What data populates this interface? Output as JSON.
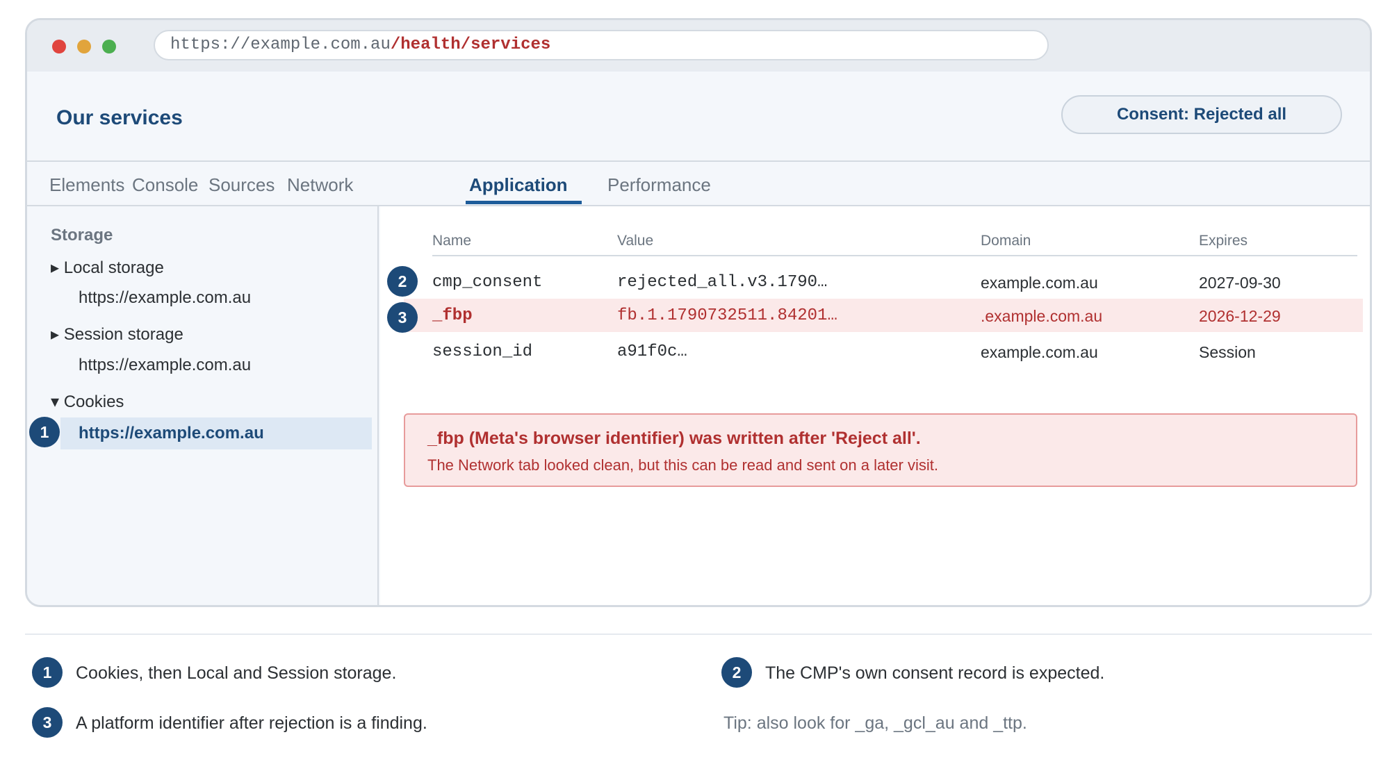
{
  "browser": {
    "url_base": "https://example.com.au",
    "url_path": "/health/services"
  },
  "page": {
    "title": "Our services",
    "consent_status": "Consent: Rejected all"
  },
  "devtools": {
    "tabs": [
      "Elements",
      "Console",
      "Sources",
      "Network",
      "Application",
      "Performance"
    ],
    "active_tab": "Application"
  },
  "sidebar": {
    "heading": "Storage",
    "local_storage": {
      "label": "▸ Local storage",
      "origin": "https://example.com.au"
    },
    "session_storage": {
      "label": "▸ Session storage",
      "origin": "https://example.com.au"
    },
    "cookies": {
      "label": "▾ Cookies",
      "origin": "https://example.com.au"
    }
  },
  "cookie_table": {
    "columns": [
      "Name",
      "Value",
      "Domain",
      "Expires"
    ],
    "rows": [
      {
        "badge": "2",
        "name": "cmp_consent",
        "value": "rejected_all.v3.1790…",
        "domain": "example.com.au",
        "expires": "2027-09-30",
        "highlight": false
      },
      {
        "badge": "3",
        "name": "_fbp",
        "value": "fb.1.1790732511.84201…",
        "domain": ".example.com.au",
        "expires": "2026-12-29",
        "highlight": true
      },
      {
        "badge": "",
        "name": "session_id",
        "value": "a91f0c…",
        "domain": "example.com.au",
        "expires": "Session",
        "highlight": false
      }
    ]
  },
  "alert": {
    "title": "_fbp (Meta's browser identifier) was written after 'Reject all'.",
    "body": "The Network tab looked clean, but this can be read and sent on a later visit."
  },
  "annotations": [
    {
      "badge": "1",
      "text": "Cookies, then Local and Session storage."
    },
    {
      "badge": "2",
      "text": "The CMP's own consent record is expected."
    },
    {
      "badge": "3",
      "text": "A platform identifier after rejection is a finding."
    }
  ],
  "tip": "Tip: also look for _ga, _gcl_au and _ttp.",
  "colors": {
    "accent": "#1d4a78",
    "warning": "#b03030",
    "warning_bg": "#fbe9e9"
  }
}
